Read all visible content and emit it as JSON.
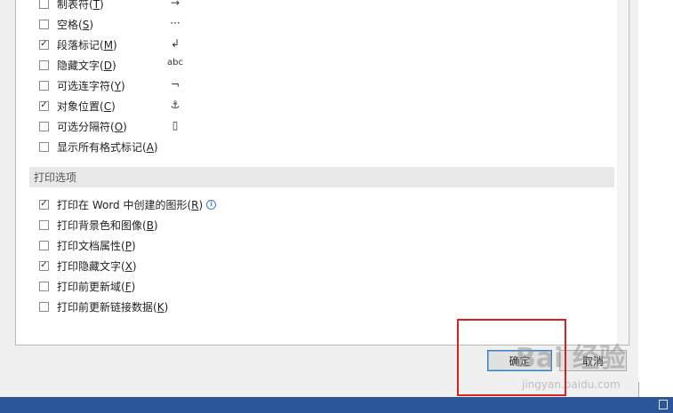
{
  "display_options": [
    {
      "label": "制表符(",
      "key": "T",
      "end": ")",
      "checked": false,
      "symbol": "→"
    },
    {
      "label": "空格(",
      "key": "S",
      "end": ")",
      "checked": false,
      "symbol": "···"
    },
    {
      "label": "段落标记(",
      "key": "M",
      "end": ")",
      "checked": true,
      "symbol": "↲"
    },
    {
      "label": "隐藏文字(",
      "key": "D",
      "end": ")",
      "checked": false,
      "symbol": "abc"
    },
    {
      "label": "可选连字符(",
      "key": "Y",
      "end": ")",
      "checked": false,
      "symbol": "¬"
    },
    {
      "label": "对象位置(",
      "key": "C",
      "end": ")",
      "checked": true,
      "symbol": "⚓"
    },
    {
      "label": "可选分隔符(",
      "key": "O",
      "end": ")",
      "checked": false,
      "symbol": "▯"
    },
    {
      "label": "显示所有格式标记(",
      "key": "A",
      "end": ")",
      "checked": false,
      "symbol": ""
    }
  ],
  "print_section": {
    "title": "打印选项"
  },
  "print_options": [
    {
      "label": "打印在 Word 中创建的图形(",
      "key": "R",
      "end": ")",
      "checked": true,
      "info": true
    },
    {
      "label": "打印背景色和图像(",
      "key": "B",
      "end": ")",
      "checked": false,
      "info": false
    },
    {
      "label": "打印文档属性(",
      "key": "P",
      "end": ")",
      "checked": false,
      "info": false
    },
    {
      "label": "打印隐藏文字(",
      "key": "X",
      "end": ")",
      "checked": true,
      "info": false
    },
    {
      "label": "打印前更新域(",
      "key": "F",
      "end": ")",
      "checked": false,
      "info": false
    },
    {
      "label": "打印前更新链接数据(",
      "key": "K",
      "end": ")",
      "checked": false,
      "info": false
    }
  ],
  "buttons": {
    "ok": "确定",
    "cancel": "取消"
  },
  "watermark": {
    "main": "Bai 经验",
    "sub": "jingyan.baidu.com"
  },
  "info_icon_glyph": "i",
  "check_glyph": "✓",
  "colors": {
    "highlight_box": "#e02020",
    "taskbar": "#2b579a"
  }
}
